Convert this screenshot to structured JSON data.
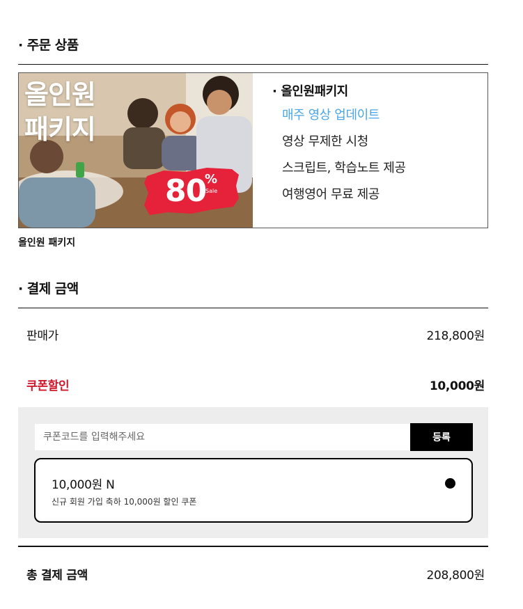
{
  "order_section": {
    "title": "주문 상품",
    "product": {
      "image_title_line1": "올인원",
      "image_title_line2": "패키지",
      "badge_number": "80",
      "badge_percent": "%",
      "badge_sale": "Sale",
      "features_title": "올인원패키지",
      "features": [
        "매주 영상 업데이트",
        "영상 무제한 시청",
        "스크립트, 학습노트 제공",
        "여행영어 무료 제공"
      ],
      "caption": "올인원 패키지"
    }
  },
  "payment_section": {
    "title": "결제 금액",
    "sale_price_label": "판매가",
    "sale_price_value": "218,800원",
    "coupon_label": "쿠폰할인",
    "coupon_value": "10,000원",
    "coupon_input_placeholder": "쿠폰코드를 입력해주세요",
    "register_label": "등록",
    "coupon": {
      "amount": "10,000원 N",
      "description": "신규 회원 가입 축하 10,000원 할인 쿠폰"
    },
    "total_label": "총 결제 금액",
    "total_value": "208,800원"
  },
  "colors": {
    "accent_red": "#d0172b",
    "highlight_blue": "#4aa6e6",
    "coupon_bg": "#ededed"
  }
}
